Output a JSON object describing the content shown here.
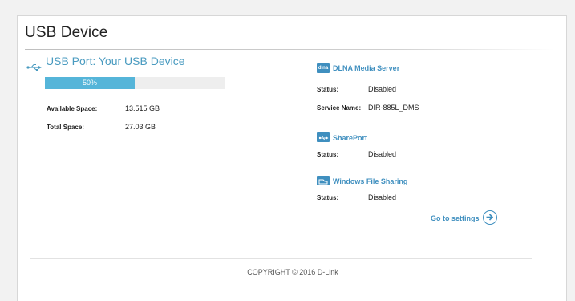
{
  "page": {
    "title": "USB Device"
  },
  "usb": {
    "heading": "USB Port: Your USB Device",
    "progress_text": "50%",
    "progress_fraction": 0.5,
    "available_label": "Available Space:",
    "available_value": "13.515 GB",
    "total_label": "Total Space:",
    "total_value": "27.03 GB"
  },
  "dlna": {
    "icon_text": "dlna",
    "title": "DLNA Media Server",
    "status_label": "Status:",
    "status_value": "Disabled",
    "service_label": "Service Name:",
    "service_value": "DIR-885L_DMS"
  },
  "shareport": {
    "title": "SharePort",
    "status_label": "Status:",
    "status_value": "Disabled"
  },
  "windows_sharing": {
    "title": "Windows File Sharing",
    "status_label": "Status:",
    "status_value": "Disabled"
  },
  "settings": {
    "link_text": "Go to settings"
  },
  "footer": {
    "copyright": "COPYRIGHT © 2016 D-Link"
  },
  "colors": {
    "accent": "#3f8fbf",
    "progress": "#55b5d9",
    "heading": "#4a9bc0"
  },
  "icons": [
    "usb-icon",
    "dlna-icon",
    "shareport-icon",
    "windows-share-icon",
    "arrow-right-icon"
  ]
}
